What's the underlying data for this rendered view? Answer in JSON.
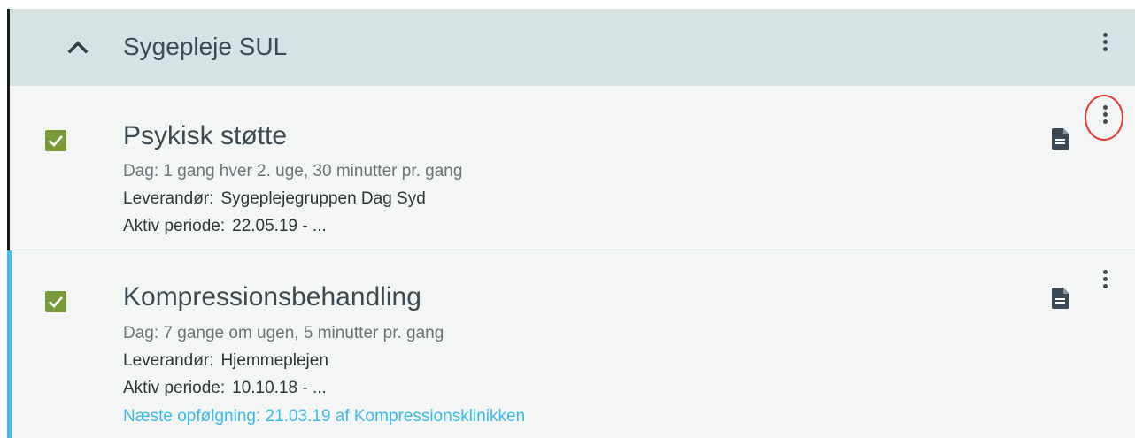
{
  "group": {
    "title": "Sygepleje SUL"
  },
  "items": [
    {
      "title": "Psykisk støtte",
      "frequency": "Dag: 1 gang hver 2. uge, 30 minutter pr. gang",
      "provider_label": "Leverandør:",
      "provider": "Sygeplejegruppen Dag Syd",
      "period_label": "Aktiv periode:",
      "period": "22.05.19  -  ..."
    },
    {
      "title": "Kompressionsbehandling",
      "frequency": "Dag: 7 gange om ugen, 5 minutter pr. gang",
      "provider_label": "Leverandør:",
      "provider": "Hjemmeplejen",
      "period_label": "Aktiv periode:",
      "period": "10.10.18  -  ...",
      "followup": "Næste opfølgning:  21.03.19  af  Kompressionsklinikken"
    }
  ],
  "colors": {
    "header_bg": "#d6e2e4",
    "checkbox": "#7a9a3a",
    "accent": "#3fbfe9",
    "highlight": "#e53935"
  },
  "icons": [
    "chevron-up-icon",
    "more-vert-icon",
    "checkbox-checked-icon",
    "document-icon"
  ]
}
